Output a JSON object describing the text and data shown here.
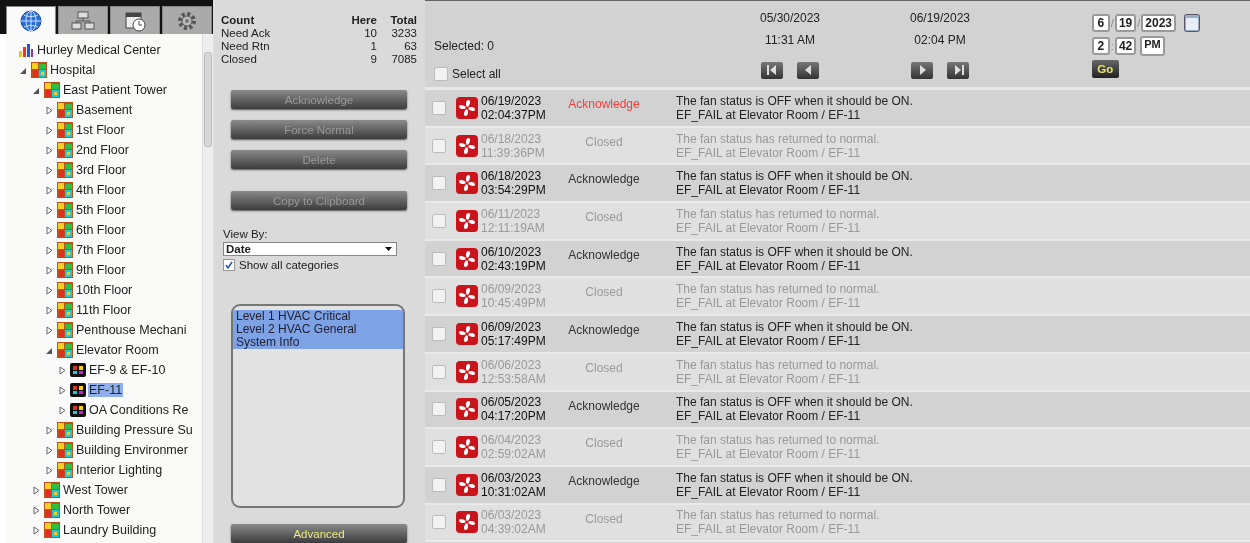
{
  "tree_tabs": [
    {
      "kind": "globe",
      "selected": true
    },
    {
      "kind": "network",
      "selected": false
    },
    {
      "kind": "schedule",
      "selected": false
    },
    {
      "kind": "settings",
      "selected": false
    }
  ],
  "tree": [
    {
      "label": "Hurley Medical Center",
      "kind": "site",
      "selected": false,
      "children": [
        {
          "label": "Hospital",
          "kind": "area",
          "expanded": true,
          "selected": false,
          "children": [
            {
              "label": "East Patient Tower",
              "kind": "area",
              "expanded": true,
              "selected": false,
              "children": [
                {
                  "label": "Basement",
                  "kind": "area",
                  "expanded": false,
                  "selected": false
                },
                {
                  "label": "1st Floor",
                  "kind": "area",
                  "expanded": false,
                  "selected": false
                },
                {
                  "label": "2nd Floor",
                  "kind": "area",
                  "expanded": false,
                  "selected": false
                },
                {
                  "label": "3rd Floor",
                  "kind": "area",
                  "expanded": false,
                  "selected": false
                },
                {
                  "label": "4th Floor",
                  "kind": "area",
                  "expanded": false,
                  "selected": false
                },
                {
                  "label": "5th Floor",
                  "kind": "area",
                  "expanded": false,
                  "selected": false
                },
                {
                  "label": "6th Floor",
                  "kind": "area",
                  "expanded": false,
                  "selected": false
                },
                {
                  "label": "7th Floor",
                  "kind": "area",
                  "expanded": false,
                  "selected": false
                },
                {
                  "label": "9th Floor",
                  "kind": "area",
                  "expanded": false,
                  "selected": false
                },
                {
                  "label": "10th Floor",
                  "kind": "area",
                  "expanded": false,
                  "selected": false
                },
                {
                  "label": "11th Floor",
                  "kind": "area",
                  "expanded": false,
                  "selected": false
                },
                {
                  "label": "Penthouse Mechani",
                  "kind": "area",
                  "expanded": false,
                  "selected": false
                },
                {
                  "label": "Elevator Room",
                  "kind": "area",
                  "expanded": true,
                  "selected": false,
                  "children": [
                    {
                      "label": "EF-9 & EF-10",
                      "kind": "device",
                      "expanded": false,
                      "selected": false
                    },
                    {
                      "label": "EF-11",
                      "kind": "device",
                      "expanded": false,
                      "selected": true
                    },
                    {
                      "label": "OA Conditions Re",
                      "kind": "device",
                      "expanded": false,
                      "selected": false
                    }
                  ]
                },
                {
                  "label": "Building Pressure Su",
                  "kind": "area",
                  "expanded": false,
                  "selected": false
                },
                {
                  "label": "Building Environmer",
                  "kind": "area",
                  "expanded": false,
                  "selected": false
                },
                {
                  "label": "Interior Lighting",
                  "kind": "area",
                  "expanded": false,
                  "selected": false
                }
              ]
            },
            {
              "label": "West Tower",
              "kind": "area",
              "expanded": false,
              "selected": false
            },
            {
              "label": "North Tower",
              "kind": "area",
              "expanded": false,
              "selected": false
            },
            {
              "label": "Laundry Building",
              "kind": "area",
              "expanded": false,
              "selected": false
            }
          ]
        }
      ]
    }
  ],
  "counts": {
    "columns": [
      "Count",
      "Here",
      "Total"
    ],
    "rows": [
      [
        "Need Ack",
        "10",
        "3233"
      ],
      [
        "Need Rtn",
        "1",
        "63"
      ],
      [
        "Closed",
        "9",
        "7085"
      ]
    ]
  },
  "actions": [
    {
      "label": "Acknowledge",
      "disabled": true
    },
    {
      "label": "Force Normal",
      "disabled": true
    },
    {
      "label": "Delete",
      "disabled": true
    },
    {
      "label": "Copy to Clipboard",
      "disabled": true
    }
  ],
  "view_by": {
    "label": "View By:",
    "value": "Date"
  },
  "show_all": {
    "label": "Show all categories",
    "checked": true
  },
  "categories": [
    {
      "label": "Level 1 HVAC Critical",
      "selected": true
    },
    {
      "label": "Level 2 HVAC General",
      "selected": true
    },
    {
      "label": "System Info",
      "selected": true
    }
  ],
  "advanced": {
    "label": "Advanced",
    "disabled": false
  },
  "selected_count": "Selected: 0",
  "select_all": {
    "label": "Select all",
    "checked": false
  },
  "range": {
    "start_date": "05/30/2023",
    "start_time": "11:31 AM",
    "end_date": "06/19/2023",
    "end_time": "02:04 PM"
  },
  "date_parts": [
    {
      "kind": "field",
      "text": "6"
    },
    {
      "kind": "sep",
      "text": "/"
    },
    {
      "kind": "field",
      "text": "19"
    },
    {
      "kind": "sep",
      "text": "/"
    },
    {
      "kind": "field",
      "text": "2023"
    }
  ],
  "time_parts": [
    {
      "kind": "field",
      "text": "2"
    },
    {
      "kind": "sep",
      "text": ":"
    },
    {
      "kind": "field",
      "text": "42"
    },
    {
      "kind": "ampm",
      "text": "PM"
    }
  ],
  "go": "Go",
  "alarms": [
    {
      "date": "06/19/2023",
      "time": "02:04:37PM",
      "status": "Acknowledge",
      "kind": "active",
      "color": "#f03c3c",
      "message": "The fan status is OFF when it should be ON.",
      "source": "EF_FAIL at Elevator Room / EF-11",
      "checked": false
    },
    {
      "date": "06/18/2023",
      "time": "11:39:36PM",
      "status": "Closed",
      "kind": "closed",
      "color": "#9a9a9a",
      "message": "The fan status has returned to normal.",
      "source": "EF_FAIL at Elevator Room / EF-11",
      "checked": false
    },
    {
      "date": "06/18/2023",
      "time": "03:54:29PM",
      "status": "Acknowledge",
      "kind": "active",
      "color": "#333333",
      "message": "The fan status is OFF when it should be ON.",
      "source": "EF_FAIL at Elevator Room / EF-11",
      "checked": false
    },
    {
      "date": "06/11/2023",
      "time": "12:11:19AM",
      "status": "Closed",
      "kind": "closed",
      "color": "#9a9a9a",
      "message": "The fan status has returned to normal.",
      "source": "EF_FAIL at Elevator Room / EF-11",
      "checked": false
    },
    {
      "date": "06/10/2023",
      "time": "02:43:19PM",
      "status": "Acknowledge",
      "kind": "active",
      "color": "#333333",
      "message": "The fan status is OFF when it should be ON.",
      "source": "EF_FAIL at Elevator Room / EF-11",
      "checked": false
    },
    {
      "date": "06/09/2023",
      "time": "10:45:49PM",
      "status": "Closed",
      "kind": "closed",
      "color": "#9a9a9a",
      "message": "The fan status has returned to normal.",
      "source": "EF_FAIL at Elevator Room / EF-11",
      "checked": false
    },
    {
      "date": "06/09/2023",
      "time": "05:17:49PM",
      "status": "Acknowledge",
      "kind": "active",
      "color": "#333333",
      "message": "The fan status is OFF when it should be ON.",
      "source": "EF_FAIL at Elevator Room / EF-11",
      "checked": false
    },
    {
      "date": "06/06/2023",
      "time": "12:53:58AM",
      "status": "Closed",
      "kind": "closed",
      "color": "#9a9a9a",
      "message": "The fan status has returned to normal.",
      "source": "EF_FAIL at Elevator Room / EF-11",
      "checked": false
    },
    {
      "date": "06/05/2023",
      "time": "04:17:20PM",
      "status": "Acknowledge",
      "kind": "active",
      "color": "#333333",
      "message": "The fan status is OFF when it should be ON.",
      "source": "EF_FAIL at Elevator Room / EF-11",
      "checked": false
    },
    {
      "date": "06/04/2023",
      "time": "02:59:02AM",
      "status": "Closed",
      "kind": "closed",
      "color": "#9a9a9a",
      "message": "The fan status has returned to normal.",
      "source": "EF_FAIL at Elevator Room / EF-11",
      "checked": false
    },
    {
      "date": "06/03/2023",
      "time": "10:31:02AM",
      "status": "Acknowledge",
      "kind": "active",
      "color": "#333333",
      "message": "The fan status is OFF when it should be ON.",
      "source": "EF_FAIL at Elevator Room / EF-11",
      "checked": false
    },
    {
      "date": "06/03/2023",
      "time": "04:39:02AM",
      "status": "Closed",
      "kind": "closed",
      "color": "#9a9a9a",
      "message": "The fan status has returned to normal.",
      "source": "EF_FAIL at Elevator Room / EF-11",
      "checked": false
    }
  ]
}
